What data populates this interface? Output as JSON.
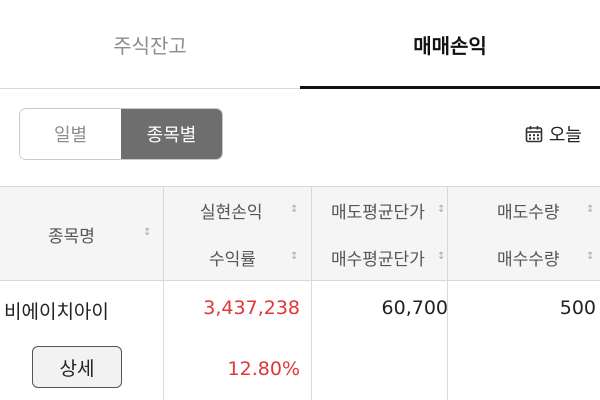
{
  "tabs": [
    {
      "label": "주식잔고",
      "active": false
    },
    {
      "label": "매매손익",
      "active": true
    }
  ],
  "segment": {
    "options": [
      "일별",
      "종목별"
    ],
    "selected": "종목별"
  },
  "date_button": {
    "label": "오늘",
    "icon": "calendar-icon"
  },
  "table": {
    "headers": {
      "name": "종목명",
      "realized_pl": "실현손익",
      "return_rate": "수익률",
      "sell_avg_price": "매도평균단가",
      "buy_avg_price": "매수평균단가",
      "sell_qty": "매도수량",
      "buy_qty": "매수수량"
    },
    "sort_icon": "↕",
    "rows": [
      {
        "name": "비에이치아이",
        "realized_pl": "3,437,238",
        "return_rate": "12.80%",
        "sell_avg_price": "60,700",
        "sell_qty": "500",
        "detail_label": "상세"
      }
    ]
  },
  "colors": {
    "profit": "#e0373a",
    "active_segment": "#6e6e6e",
    "header_bg": "#f5f5f5"
  }
}
